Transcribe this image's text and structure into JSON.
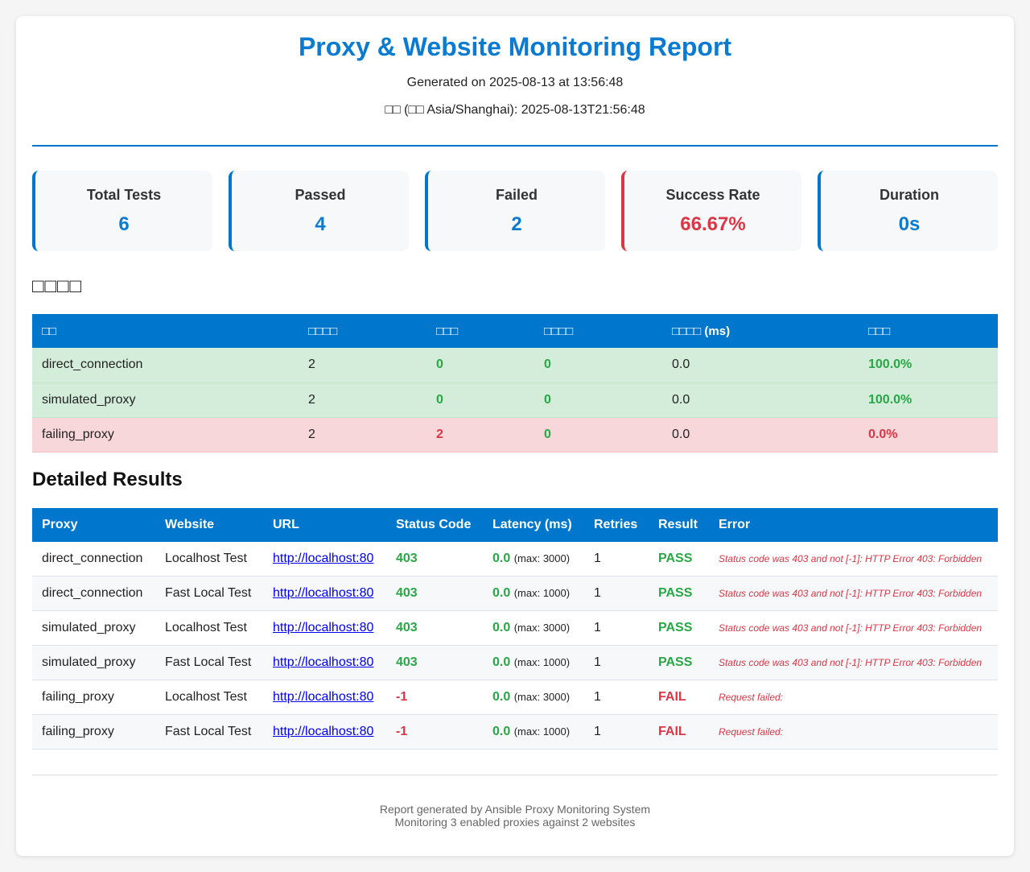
{
  "header": {
    "title": "Proxy & Website Monitoring Report",
    "generated": "Generated on 2025-08-13 at 13:56:48",
    "timezone_line": "□□ (□□ Asia/Shanghai): 2025-08-13T21:56:48"
  },
  "stats": [
    {
      "label": "Total Tests",
      "value": "6"
    },
    {
      "label": "Passed",
      "value": "4"
    },
    {
      "label": "Failed",
      "value": "2"
    },
    {
      "label": "Success Rate",
      "value": "66.67%"
    },
    {
      "label": "Duration",
      "value": "0s"
    }
  ],
  "summary": {
    "heading": "□□□□",
    "columns": [
      "□□",
      "□□□□",
      "□□□",
      "□□□□",
      "□□□□ (ms)",
      "□□□"
    ],
    "rows": [
      {
        "proxy": "direct_connection",
        "total": "2",
        "failed": "0",
        "retries": "0",
        "latency": "0.0",
        "rate": "100.0%"
      },
      {
        "proxy": "simulated_proxy",
        "total": "2",
        "failed": "0",
        "retries": "0",
        "latency": "0.0",
        "rate": "100.0%"
      },
      {
        "proxy": "failing_proxy",
        "total": "2",
        "failed": "2",
        "retries": "0",
        "latency": "0.0",
        "rate": "0.0%"
      }
    ]
  },
  "details": {
    "heading": "Detailed Results",
    "columns": [
      "Proxy",
      "Website",
      "URL",
      "Status Code",
      "Latency (ms)",
      "Retries",
      "Result",
      "Error"
    ],
    "rows": [
      {
        "proxy": "direct_connection",
        "website": "Localhost Test",
        "url": "http://localhost:80",
        "status": "403",
        "latency": "0.0",
        "max": "(max: 3000)",
        "retries": "1",
        "result": "PASS",
        "error": "Status code was 403 and not [-1]: HTTP Error 403: Forbidden"
      },
      {
        "proxy": "direct_connection",
        "website": "Fast Local Test",
        "url": "http://localhost:80",
        "status": "403",
        "latency": "0.0",
        "max": "(max: 1000)",
        "retries": "1",
        "result": "PASS",
        "error": "Status code was 403 and not [-1]: HTTP Error 403: Forbidden"
      },
      {
        "proxy": "simulated_proxy",
        "website": "Localhost Test",
        "url": "http://localhost:80",
        "status": "403",
        "latency": "0.0",
        "max": "(max: 3000)",
        "retries": "1",
        "result": "PASS",
        "error": "Status code was 403 and not [-1]: HTTP Error 403: Forbidden"
      },
      {
        "proxy": "simulated_proxy",
        "website": "Fast Local Test",
        "url": "http://localhost:80",
        "status": "403",
        "latency": "0.0",
        "max": "(max: 1000)",
        "retries": "1",
        "result": "PASS",
        "error": "Status code was 403 and not [-1]: HTTP Error 403: Forbidden"
      },
      {
        "proxy": "failing_proxy",
        "website": "Localhost Test",
        "url": "http://localhost:80",
        "status": "-1",
        "latency": "0.0",
        "max": "(max: 3000)",
        "retries": "1",
        "result": "FAIL",
        "error": "Request failed:"
      },
      {
        "proxy": "failing_proxy",
        "website": "Fast Local Test",
        "url": "http://localhost:80",
        "status": "-1",
        "latency": "0.0",
        "max": "(max: 1000)",
        "retries": "1",
        "result": "FAIL",
        "error": "Request failed:"
      }
    ]
  },
  "footer": {
    "line1": "Report generated by Ansible Proxy Monitoring System",
    "line2": "Monitoring 3 enabled proxies against 2 websites"
  },
  "colors": {
    "accent": "#0077cc",
    "pass": "#28a745",
    "fail": "#dc3545",
    "row_ok_bg": "#d4edda",
    "row_bad_bg": "#f8d7da"
  }
}
